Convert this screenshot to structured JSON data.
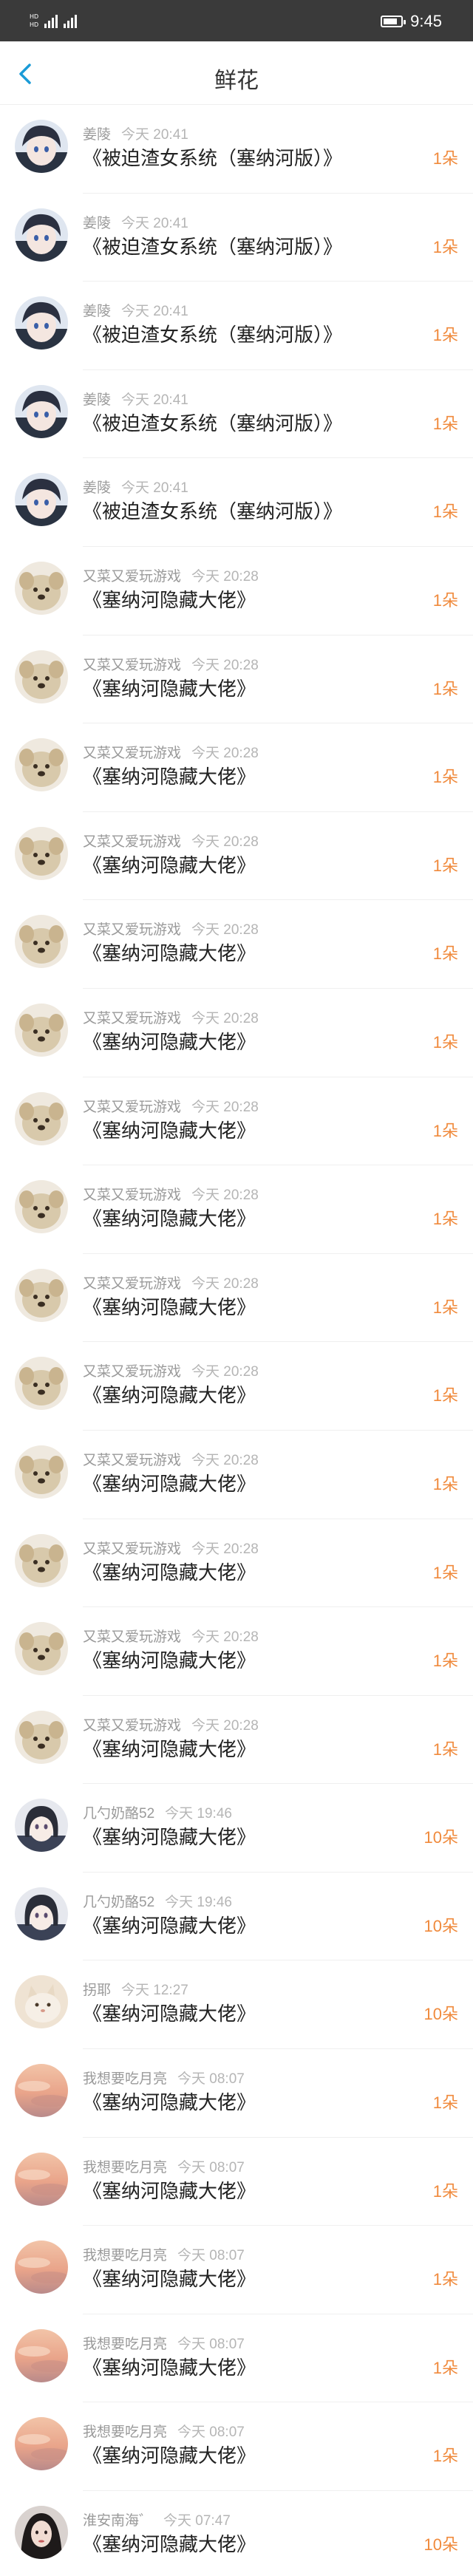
{
  "status_bar": {
    "sim1": "HD",
    "sim2": "HD",
    "time": "9:45"
  },
  "header": {
    "title": "鲜花"
  },
  "items": [
    {
      "user": "姜陵",
      "time": "今天 20:41",
      "book": "《被迫渣女系统（塞纳河版）》",
      "count": "1朵",
      "avatar": "anime-boy"
    },
    {
      "user": "姜陵",
      "time": "今天 20:41",
      "book": "《被迫渣女系统（塞纳河版）》",
      "count": "1朵",
      "avatar": "anime-boy"
    },
    {
      "user": "姜陵",
      "time": "今天 20:41",
      "book": "《被迫渣女系统（塞纳河版）》",
      "count": "1朵",
      "avatar": "anime-boy"
    },
    {
      "user": "姜陵",
      "time": "今天 20:41",
      "book": "《被迫渣女系统（塞纳河版）》",
      "count": "1朵",
      "avatar": "anime-boy"
    },
    {
      "user": "姜陵",
      "time": "今天 20:41",
      "book": "《被迫渣女系统（塞纳河版）》",
      "count": "1朵",
      "avatar": "anime-boy"
    },
    {
      "user": "又菜又爱玩游戏",
      "time": "今天 20:28",
      "book": "《塞纳河隐藏大佬》",
      "count": "1朵",
      "avatar": "dog"
    },
    {
      "user": "又菜又爱玩游戏",
      "time": "今天 20:28",
      "book": "《塞纳河隐藏大佬》",
      "count": "1朵",
      "avatar": "dog"
    },
    {
      "user": "又菜又爱玩游戏",
      "time": "今天 20:28",
      "book": "《塞纳河隐藏大佬》",
      "count": "1朵",
      "avatar": "dog"
    },
    {
      "user": "又菜又爱玩游戏",
      "time": "今天 20:28",
      "book": "《塞纳河隐藏大佬》",
      "count": "1朵",
      "avatar": "dog"
    },
    {
      "user": "又菜又爱玩游戏",
      "time": "今天 20:28",
      "book": "《塞纳河隐藏大佬》",
      "count": "1朵",
      "avatar": "dog"
    },
    {
      "user": "又菜又爱玩游戏",
      "time": "今天 20:28",
      "book": "《塞纳河隐藏大佬》",
      "count": "1朵",
      "avatar": "dog"
    },
    {
      "user": "又菜又爱玩游戏",
      "time": "今天 20:28",
      "book": "《塞纳河隐藏大佬》",
      "count": "1朵",
      "avatar": "dog"
    },
    {
      "user": "又菜又爱玩游戏",
      "time": "今天 20:28",
      "book": "《塞纳河隐藏大佬》",
      "count": "1朵",
      "avatar": "dog"
    },
    {
      "user": "又菜又爱玩游戏",
      "time": "今天 20:28",
      "book": "《塞纳河隐藏大佬》",
      "count": "1朵",
      "avatar": "dog"
    },
    {
      "user": "又菜又爱玩游戏",
      "time": "今天 20:28",
      "book": "《塞纳河隐藏大佬》",
      "count": "1朵",
      "avatar": "dog"
    },
    {
      "user": "又菜又爱玩游戏",
      "time": "今天 20:28",
      "book": "《塞纳河隐藏大佬》",
      "count": "1朵",
      "avatar": "dog"
    },
    {
      "user": "又菜又爱玩游戏",
      "time": "今天 20:28",
      "book": "《塞纳河隐藏大佬》",
      "count": "1朵",
      "avatar": "dog"
    },
    {
      "user": "又菜又爱玩游戏",
      "time": "今天 20:28",
      "book": "《塞纳河隐藏大佬》",
      "count": "1朵",
      "avatar": "dog"
    },
    {
      "user": "又菜又爱玩游戏",
      "time": "今天 20:28",
      "book": "《塞纳河隐藏大佬》",
      "count": "1朵",
      "avatar": "dog"
    },
    {
      "user": "几勺奶酪52",
      "time": "今天 19:46",
      "book": "《塞纳河隐藏大佬》",
      "count": "10朵",
      "avatar": "anime-girl"
    },
    {
      "user": "几勺奶酪52",
      "time": "今天 19:46",
      "book": "《塞纳河隐藏大佬》",
      "count": "10朵",
      "avatar": "anime-girl"
    },
    {
      "user": "拐耶",
      "time": "今天 12:27",
      "book": "《塞纳河隐藏大佬》",
      "count": "10朵",
      "avatar": "cat"
    },
    {
      "user": "我想要吃月亮",
      "time": "今天 08:07",
      "book": "《塞纳河隐藏大佬》",
      "count": "1朵",
      "avatar": "sunset"
    },
    {
      "user": "我想要吃月亮",
      "time": "今天 08:07",
      "book": "《塞纳河隐藏大佬》",
      "count": "1朵",
      "avatar": "sunset"
    },
    {
      "user": "我想要吃月亮",
      "time": "今天 08:07",
      "book": "《塞纳河隐藏大佬》",
      "count": "1朵",
      "avatar": "sunset"
    },
    {
      "user": "我想要吃月亮",
      "time": "今天 08:07",
      "book": "《塞纳河隐藏大佬》",
      "count": "1朵",
      "avatar": "sunset"
    },
    {
      "user": "我想要吃月亮",
      "time": "今天 08:07",
      "book": "《塞纳河隐藏大佬》",
      "count": "1朵",
      "avatar": "sunset"
    },
    {
      "user": "淮安南海゛",
      "time": "今天 07:47",
      "book": "《塞纳河隐藏大佬》",
      "count": "10朵",
      "avatar": "portrait"
    }
  ],
  "colors": {
    "accent": "#1a9bd7",
    "count": "#f08a3c",
    "status_bar": "#3a3a3a"
  }
}
